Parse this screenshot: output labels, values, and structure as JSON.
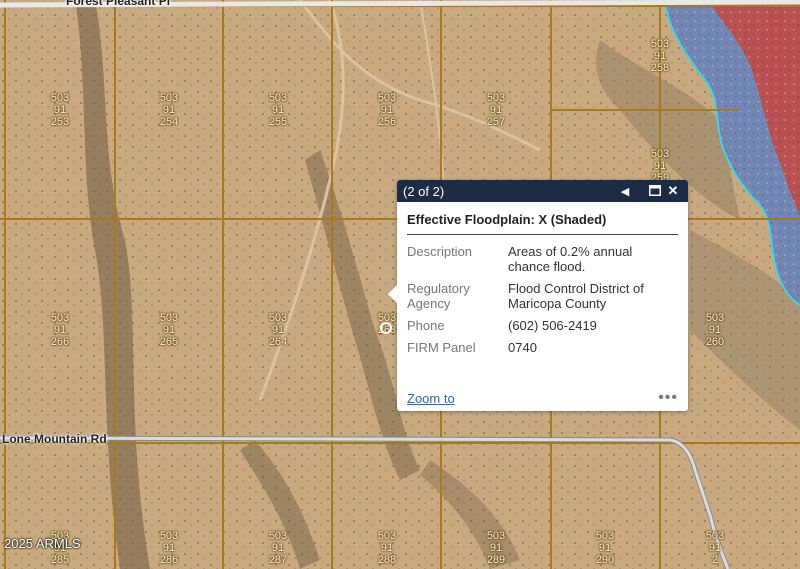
{
  "map": {
    "roads": {
      "top": "Forest Pleasant Pl",
      "middle": "Lone Mountain Rd"
    },
    "copyright": "2025 ARMLS",
    "parcels": [
      {
        "book": "503",
        "map": "91",
        "num": "253"
      },
      {
        "book": "503",
        "map": "91",
        "num": "254"
      },
      {
        "book": "503",
        "map": "91",
        "num": "255"
      },
      {
        "book": "503",
        "map": "91",
        "num": "256"
      },
      {
        "book": "503",
        "map": "91",
        "num": "257"
      },
      {
        "book": "503",
        "map": "91",
        "num": "258"
      },
      {
        "book": "503",
        "map": "91",
        "num": "259"
      },
      {
        "book": "503",
        "map": "91",
        "num": "266"
      },
      {
        "book": "503",
        "map": "91",
        "num": "265"
      },
      {
        "book": "503",
        "map": "91",
        "num": "264"
      },
      {
        "book": "503",
        "map": "",
        "num": "263"
      },
      {
        "book": "503",
        "map": "91",
        "num": "260"
      },
      {
        "book": "503",
        "map": "91",
        "num": "285"
      },
      {
        "book": "503",
        "map": "91",
        "num": "286"
      },
      {
        "book": "503",
        "map": "91",
        "num": "287"
      },
      {
        "book": "503",
        "map": "91",
        "num": "288"
      },
      {
        "book": "503",
        "map": "91",
        "num": "289"
      },
      {
        "book": "503",
        "map": "91",
        "num": "290"
      },
      {
        "book": "503",
        "map": "91",
        "num": "2"
      }
    ],
    "colors": {
      "parcel_line": "#a87a1e",
      "flood_blue": "#5f7fc2",
      "flood_red": "#c8473f",
      "flood_boundary": "#3fd6e0",
      "popup_header": "#1d2c46"
    }
  },
  "popup": {
    "counter": "(2 of 2)",
    "prev_icon": "◀",
    "maximize_icon": "▭",
    "close_icon": "✕",
    "title": "Effective Floodplain: X (Shaded)",
    "fields": [
      {
        "label": "Description",
        "value": "Areas of 0.2% annual chance flood."
      },
      {
        "label": "Regulatory Agency",
        "value": "Flood Control District of Maricopa County"
      },
      {
        "label": "Phone",
        "value": "(602) 506-2419"
      },
      {
        "label": "FIRM Panel",
        "value": "0740"
      }
    ],
    "zoom_label": "Zoom to",
    "more_label": "•••"
  }
}
